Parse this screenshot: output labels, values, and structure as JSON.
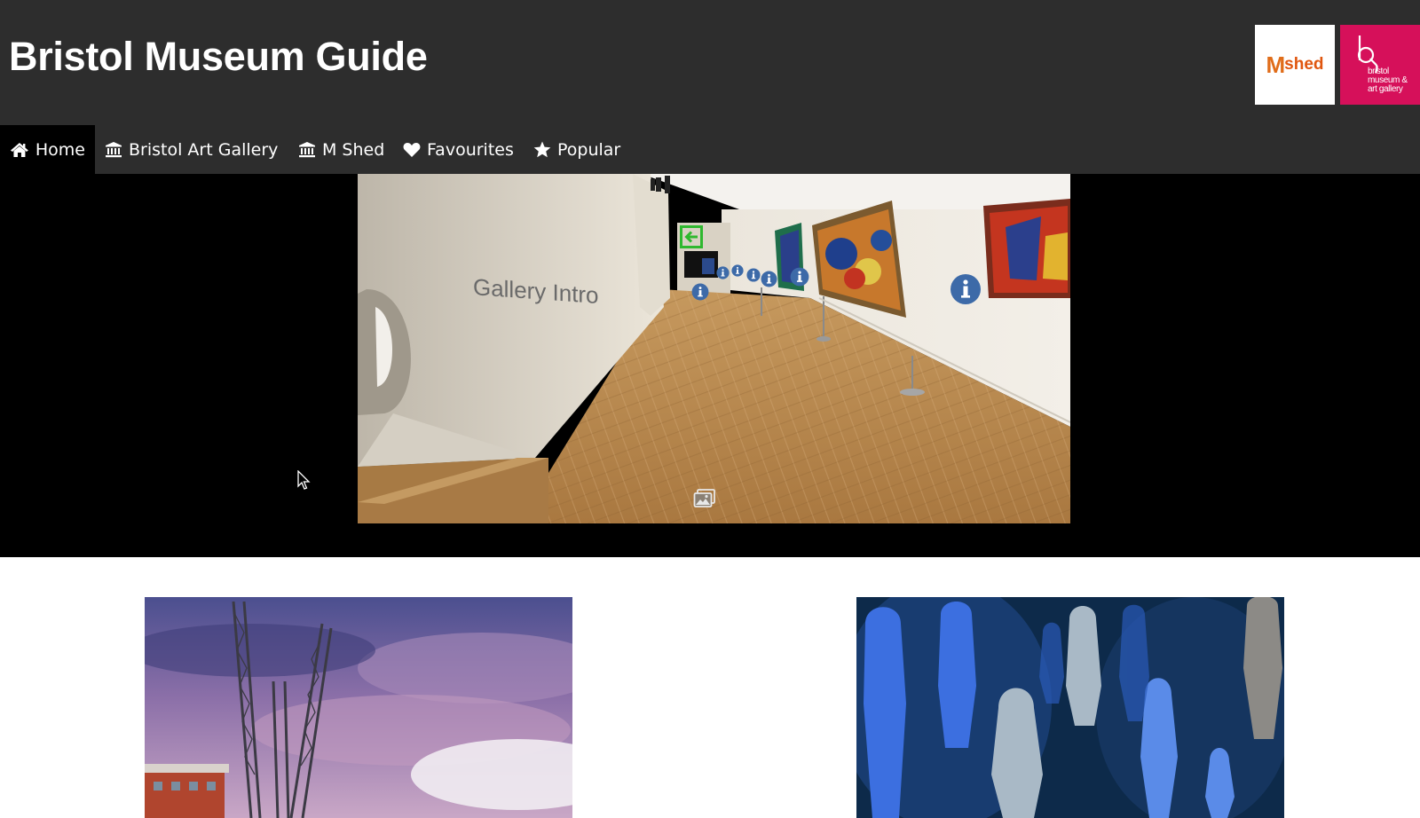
{
  "header": {
    "title": "Bristol Museum Guide",
    "logos": {
      "mshed": {
        "m": "M",
        "shed": "shed"
      },
      "bmag": {
        "text": "bristol\nmuseum &\nart gallery"
      }
    }
  },
  "nav": {
    "items": [
      {
        "label": "Home",
        "icon": "home-icon",
        "active": true
      },
      {
        "label": "Bristol Art Gallery",
        "icon": "museum-icon",
        "active": false
      },
      {
        "label": "M Shed",
        "icon": "museum-icon",
        "active": false
      },
      {
        "label": "Favourites",
        "icon": "heart-icon",
        "active": false
      },
      {
        "label": "Popular",
        "icon": "star-icon",
        "active": false
      }
    ]
  },
  "panorama": {
    "wall_sign": "Gallery Intro",
    "hotspot_icon": "info-icon",
    "nav_icon": "back-arrow-icon",
    "toolbar_icon": "gallery-image-icon"
  },
  "cards": [
    {
      "name": "mshed-cranes-card"
    },
    {
      "name": "egyptian-figures-card"
    }
  ],
  "colors": {
    "header_bg": "#2d2d2d",
    "nav_active_bg": "#000000",
    "mshed_orange": "#e0560f",
    "bmag_pink": "#d6105a",
    "hotspot_blue": "#3d6aa8"
  }
}
